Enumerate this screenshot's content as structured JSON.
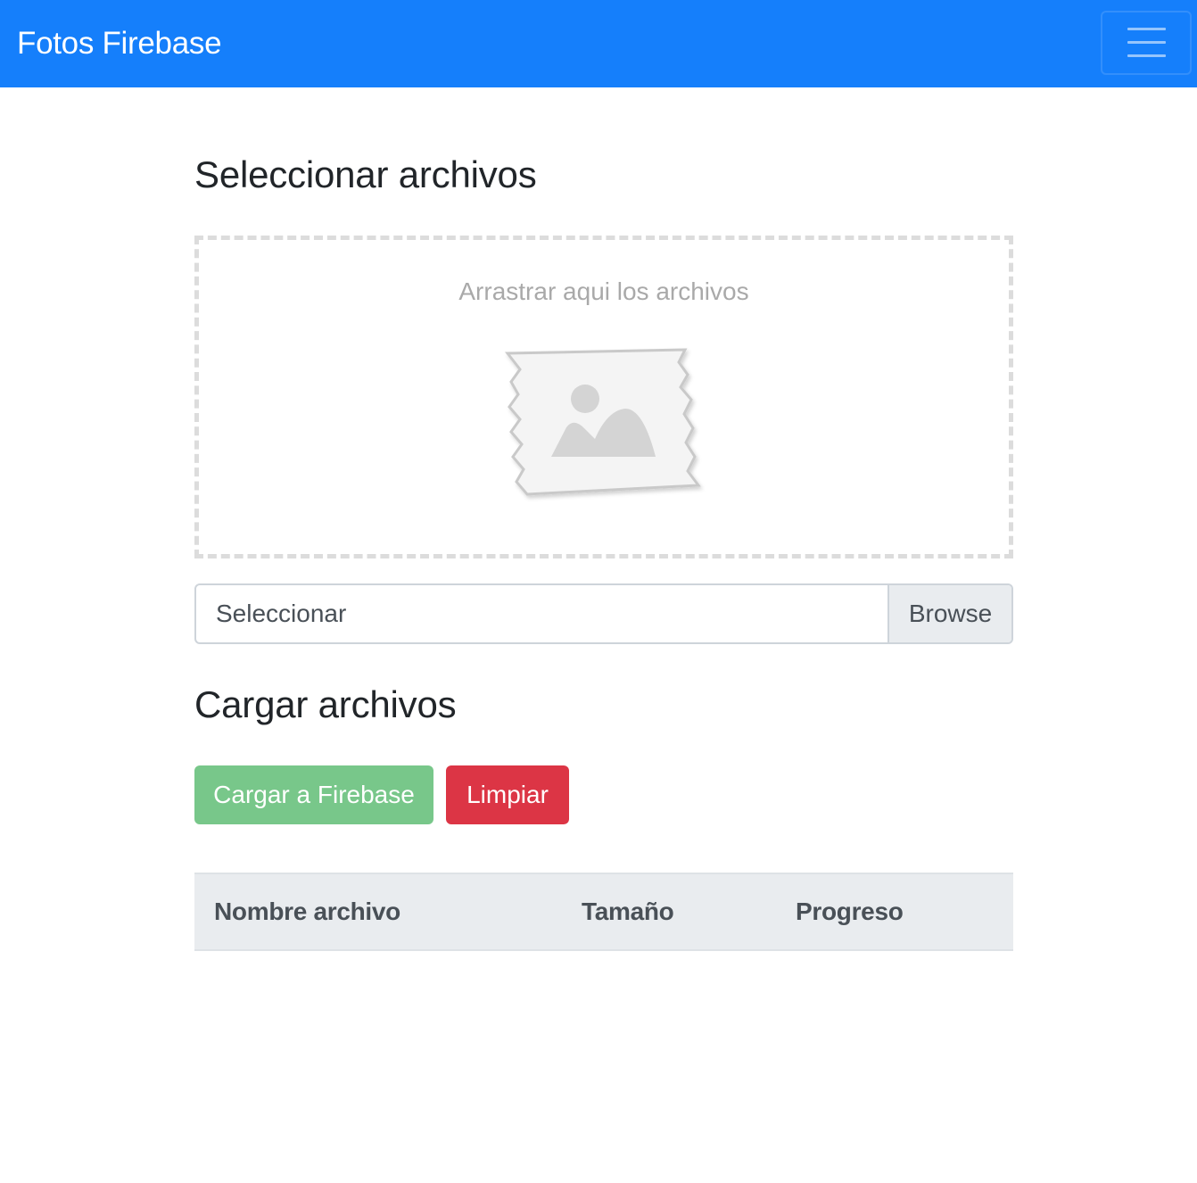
{
  "navbar": {
    "brand": "Fotos Firebase",
    "toggler_icon": "hamburger-menu-icon",
    "background_color": "#157ffb"
  },
  "select_section": {
    "title": "Seleccionar archivos",
    "dropzone": {
      "hint": "Arrastrar aqui los archivos",
      "placeholder_icon": "image-placeholder-icon"
    },
    "file_input": {
      "label": "Seleccionar",
      "browse_label": "Browse"
    }
  },
  "upload_section": {
    "title": "Cargar archivos",
    "upload_button": "Cargar a Firebase",
    "clear_button": "Limpiar",
    "colors": {
      "upload": "#78c78a",
      "clear": "#dc3545"
    }
  },
  "table": {
    "columns": [
      "Nombre archivo",
      "Tamaño",
      "Progreso"
    ],
    "rows": []
  }
}
